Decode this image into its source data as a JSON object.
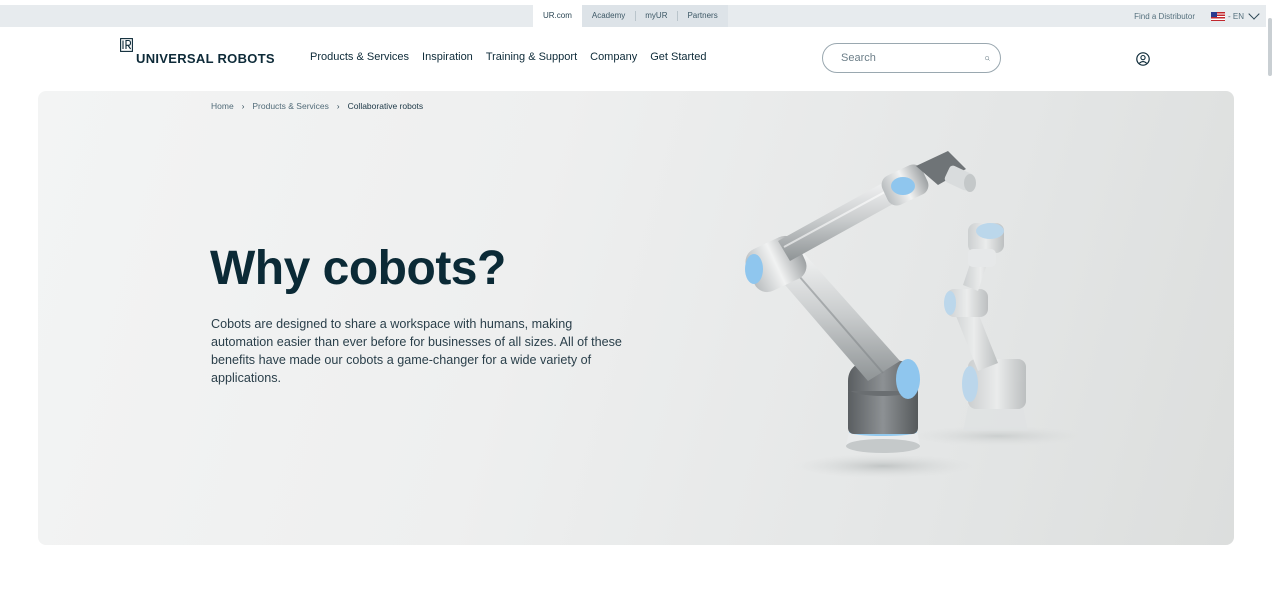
{
  "topbar": {
    "site_tabs": [
      "UR.com",
      "Academy",
      "myUR",
      "Partners"
    ],
    "find_distributor": "Find a Distributor",
    "language": "- EN"
  },
  "header": {
    "logo_text": "UNIVERSAL ROBOTS",
    "nav": [
      "Products & Services",
      "Inspiration",
      "Training & Support",
      "Company",
      "Get Started"
    ],
    "search_placeholder": "Search"
  },
  "hero": {
    "breadcrumb": [
      "Home",
      "Products & Services",
      "Collaborative robots"
    ],
    "title": "Why cobots?",
    "description": "Cobots are designed to share a workspace with humans, making automation easier than ever before for businesses of all sizes. All of these benefits have made our cobots a game-changer for a wide variety of applications."
  },
  "colors": {
    "brand_dark": "#0d2a38",
    "robot_blue": "#8fc6ee",
    "topbar_bg": "#e7ebee"
  },
  "icons": {
    "search": "search-icon",
    "account": "user-circle-icon",
    "language_chevron": "chevron-down-icon",
    "flag": "us-flag-icon"
  }
}
